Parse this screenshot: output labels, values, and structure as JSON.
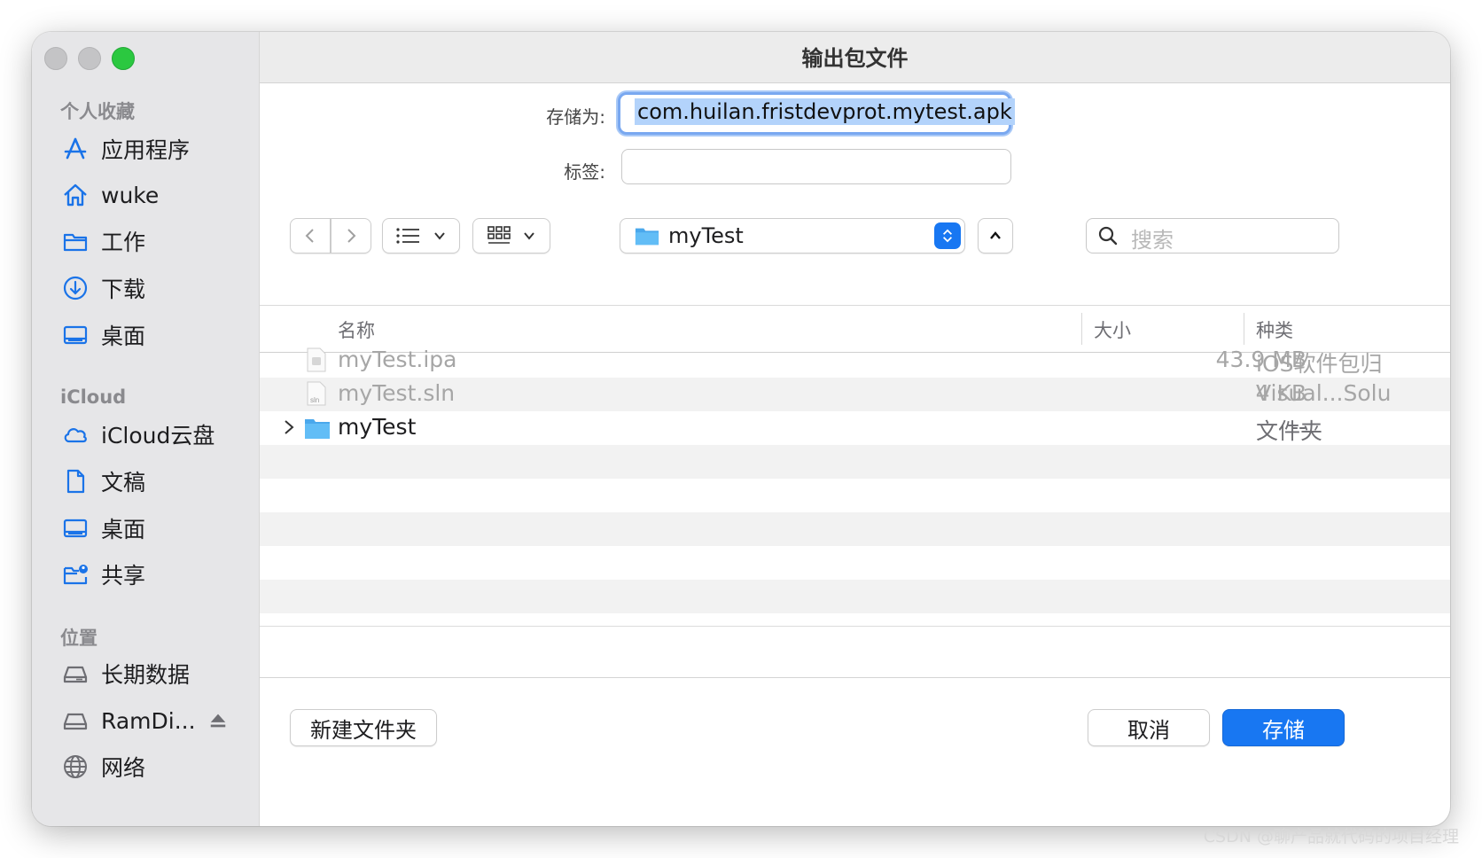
{
  "dialog": {
    "title": "输出包文件"
  },
  "sidebar": {
    "favorites_title": "个人收藏",
    "favorites": [
      {
        "label": "应用程序",
        "icon": "apps-icon"
      },
      {
        "label": "wuke",
        "icon": "home-icon"
      },
      {
        "label": "工作",
        "icon": "folder-icon"
      },
      {
        "label": "下载",
        "icon": "download-icon"
      },
      {
        "label": "桌面",
        "icon": "desktop-icon"
      }
    ],
    "icloud_title": "iCloud",
    "icloud": [
      {
        "label": "iCloud云盘",
        "icon": "cloud-icon"
      },
      {
        "label": "文稿",
        "icon": "document-icon"
      },
      {
        "label": "桌面",
        "icon": "desktop-icon"
      },
      {
        "label": "共享",
        "icon": "shared-folder-icon"
      }
    ],
    "locations_title": "位置",
    "locations": [
      {
        "label": "长期数据",
        "icon": "drive-icon"
      },
      {
        "label": "RamDi...",
        "icon": "drive-icon"
      },
      {
        "label": "网络",
        "icon": "network-icon"
      }
    ]
  },
  "form": {
    "save_as_label": "存储为:",
    "save_as_value": "com.huilan.fristdevprot.mytest.apk",
    "tags_label": "标签:",
    "tags_value": ""
  },
  "toolbar": {
    "location": "myTest",
    "search_placeholder": "搜索"
  },
  "table": {
    "columns": [
      "名称",
      "大小",
      "种类"
    ],
    "rows": [
      {
        "name": "myTest.ipa",
        "size": "43.9 MB",
        "kind": "iOS软件包归",
        "enabled": false,
        "icon": "ipa-file-icon"
      },
      {
        "name": "myTest.sln",
        "size": "4 KB",
        "kind": "Visual...Solu",
        "enabled": false,
        "icon": "sln-file-icon"
      },
      {
        "name": "myTest",
        "size": "--",
        "kind": "文件夹",
        "enabled": true,
        "icon": "folder-icon"
      }
    ]
  },
  "footer": {
    "new_folder": "新建文件夹",
    "cancel": "取消",
    "save": "存储"
  },
  "watermark": "CSDN @聊产品就代码的项目经理",
  "colors": {
    "accent": "#1877f2",
    "sidebar_bg": "#e6e6e8",
    "selection": "#b3d3fb"
  }
}
